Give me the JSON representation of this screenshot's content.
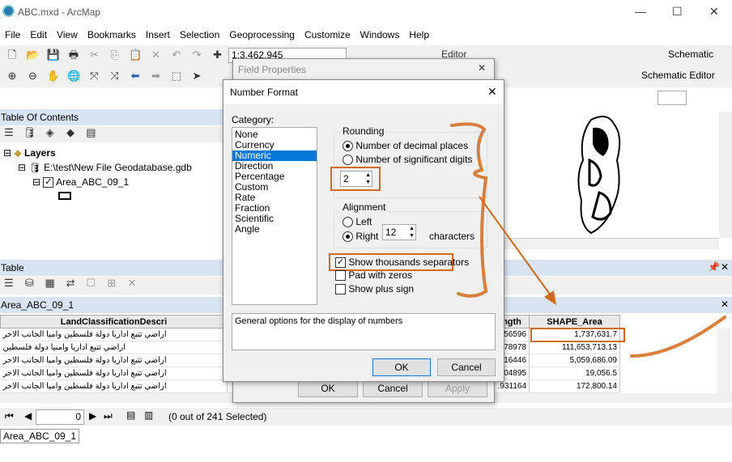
{
  "app": {
    "title": "ABC.mxd - ArcMap",
    "minimize": "—",
    "maximize": "☐",
    "close": "✕"
  },
  "menu": [
    "File",
    "Edit",
    "View",
    "Bookmarks",
    "Insert",
    "Selection",
    "Geoprocessing",
    "Customize",
    "Windows",
    "Help"
  ],
  "toolbar": {
    "scale": "1:3,462,945",
    "editor": "Editor",
    "schematic": "Schematic",
    "schematic_editor": "Schematic Editor"
  },
  "toc": {
    "title": "Table Of Contents",
    "layers": "Layers",
    "gdb": "E:\\test\\New File Geodatabase.gdb",
    "layer": "Area_ABC_09_1"
  },
  "table": {
    "title": "Table",
    "tab_name": "Area_ABC_09_1",
    "columns": {
      "land": "LandClassificationDescri",
      "length": "ngth",
      "area": "SHAPE_Area"
    },
    "rows": [
      {
        "land": "اراضي تتبع اداريا دولة فلسطين واميا الجانب الاخر",
        "length": "56596",
        "area": "1,737,631.7"
      },
      {
        "land": "اراضي تتبع اداريا وامنيا دولة فلسطين",
        "length": "78978",
        "area": "111,653,713.13"
      },
      {
        "land": "اراضي تتبع اداريا دولة فلسطين واميا الجانب الاخر",
        "length": "16446",
        "area": "5,059,686.09"
      },
      {
        "land": "اراضي تتبع اداريا دولة فلسطين واميا الجانب الاخر",
        "length": "04895",
        "area": "19,056.5"
      },
      {
        "land": "اراضي تتبع اداريا دولة فلسطين واميا الجانب الاخر",
        "length": ".931164",
        "area": "172,800.14"
      }
    ],
    "record": "0",
    "selected": "(0 out of 241 Selected)",
    "bottom_tab": "Area_ABC_09_1"
  },
  "field_props": {
    "title": "Field Properties",
    "ok": "OK",
    "cancel": "Cancel",
    "apply": "Apply"
  },
  "number_format": {
    "title": "Number Format",
    "category_label": "Category:",
    "categories": [
      "None",
      "Currency",
      "Numeric",
      "Direction",
      "Percentage",
      "Custom",
      "Rate",
      "Fraction",
      "Scientific",
      "Angle"
    ],
    "selected_category": "Numeric",
    "rounding": {
      "label": "Rounding",
      "opt1": "Number of decimal places",
      "opt2": "Number of significant digits",
      "value": "2"
    },
    "alignment": {
      "label": "Alignment",
      "left": "Left",
      "right": "Right",
      "value": "12",
      "chars": "characters"
    },
    "thousands": "Show thousands separators",
    "pad": "Pad with zeros",
    "plus": "Show plus sign",
    "description": "General options for the display of numbers",
    "ok": "OK",
    "cancel": "Cancel"
  },
  "colors": {
    "annotation": "#d2691e",
    "selection": "#0078d7",
    "panel_header": "#d8e4f2"
  }
}
